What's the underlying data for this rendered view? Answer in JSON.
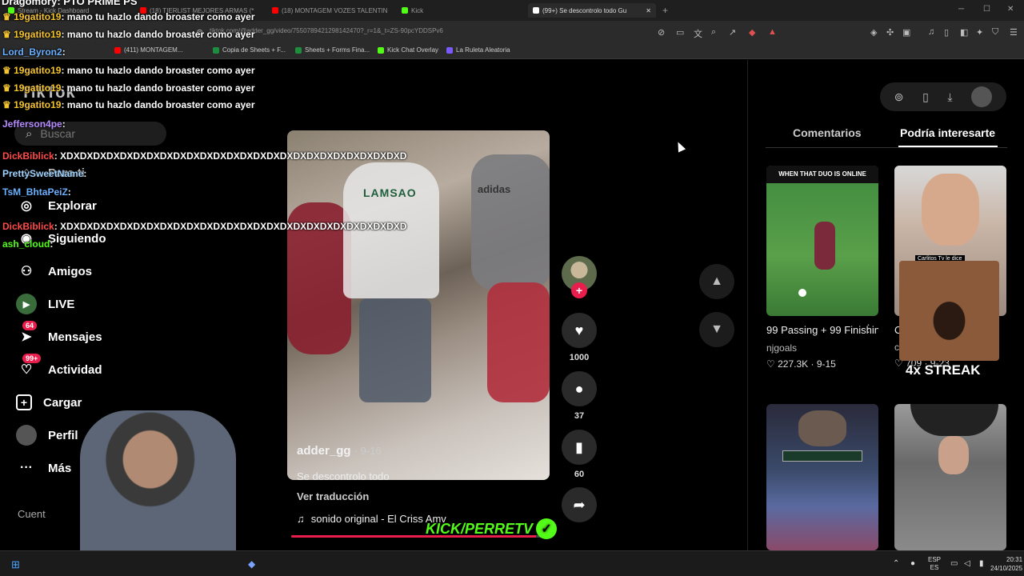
{
  "browser": {
    "tabs": [
      {
        "label": "Stream - Kick Dashboard",
        "color": "#53fc18"
      },
      {
        "label": "(18) TIERLIST MEJORES ARMAS (*",
        "color": "#ff0000"
      },
      {
        "label": "(18) MONTAGEM VOZES TALENTIN",
        "color": "#ff0000"
      },
      {
        "label": "Kick",
        "color": "#53fc18"
      },
      {
        "label": "(99+) Se descontrolo todo Gu",
        "color": "#ffffff"
      }
    ],
    "new_tab": "+",
    "url": "tiktok.com/@adder_gg/video/7550789421298142470?_r=1&_t=ZS-90pcYDDSPv6",
    "bookmarks": [
      {
        "label": "(411) MONTAGEM...",
        "color": "#ff0000"
      },
      {
        "label": "Copia de Sheets + F...",
        "color": "#1e8e3e"
      },
      {
        "label": "Sheets + Forms Fina...",
        "color": "#1e8e3e"
      },
      {
        "label": "Kick Chat Overlay",
        "color": "#53fc18"
      },
      {
        "label": "La Ruleta Aleatoria",
        "color": "#7a5af8"
      }
    ],
    "win_min": "─",
    "win_max": "☐",
    "win_close": "✕"
  },
  "tiktok": {
    "logo": "TikTok",
    "search_placeholder": "Buscar",
    "nav": [
      {
        "label": "Para ti",
        "icon": "home-icon"
      },
      {
        "label": "Explorar",
        "icon": "compass-icon"
      },
      {
        "label": "Siguiendo",
        "icon": "following-icon"
      },
      {
        "label": "Amigos",
        "icon": "friends-icon"
      },
      {
        "label": "LIVE",
        "icon": "live-icon"
      },
      {
        "label": "Mensajes",
        "icon": "messages-icon",
        "badge": "64"
      },
      {
        "label": "Actividad",
        "icon": "activity-icon",
        "badge": "99+"
      },
      {
        "label": "Cargar",
        "icon": "upload-icon"
      },
      {
        "label": "Perfil",
        "icon": "profile-icon"
      },
      {
        "label": "Más",
        "icon": "more-icon"
      }
    ],
    "cuentas_label": "Cuent",
    "video": {
      "author": "adder_gg",
      "date": "· 9-16",
      "description": "Se descontrolo todo",
      "translate": "Ver traducción",
      "sound": "sonido original - El Criss Amv",
      "progress": 0.95,
      "shirt_text_1": "LAMSAO",
      "shirt_text_2": "adidas"
    },
    "actions": {
      "likes": "1000",
      "comments": "37",
      "saves": "60"
    },
    "panel": {
      "tab_comments": "Comentarios",
      "tab_interest": "Podría interesarte",
      "cards": [
        {
          "overlay": "WHEN THAT DUO IS ONLINE",
          "title": "99 Passing + 99 Finishing☠️ 🔥 ...",
          "author": "njgoals",
          "likes": "227.3K",
          "date": "9-15"
        },
        {
          "overlay": "Carlitos Tv le dice",
          "title": "C",
          "author": "clips_kick1",
          "likes": "709",
          "date": "9-23"
        },
        {
          "overlay": "",
          "title": "",
          "author": "",
          "likes": "",
          "date": ""
        },
        {
          "overlay": "",
          "title": "",
          "author": "",
          "likes": "",
          "date": ""
        }
      ]
    }
  },
  "stream_overlay": {
    "top_user": "Dragomory: PTO PRIME PS",
    "chat": [
      {
        "user": "19gatito19",
        "message": "mano tu hazlo dando broaster como ayer",
        "color": "#f4c430"
      },
      {
        "user": "19gatito19",
        "message": "mano tu hazlo dando broaster como ayer",
        "color": "#f4c430"
      },
      {
        "user": "Lord_Byron2",
        "message": "",
        "color": "#6ab0ff"
      },
      {
        "user": "19gatito19",
        "message": "mano tu hazlo dando broaster como ayer",
        "color": "#f4c430"
      },
      {
        "user": "19gatito19",
        "message": "mano tu hazlo dando broaster como ayer",
        "color": "#f4c430"
      },
      {
        "user": "19gatito19",
        "message": "mano tu hazlo dando broaster como ayer",
        "color": "#f4c430"
      },
      {
        "user": "Jefferson4pe",
        "message": "",
        "color": "#b58cff"
      },
      {
        "user": "DickBiblick",
        "message": "XDXDXDXDXDXDXDXDXDXDXDXDXDXDXDXDXDXDXDXDXDXDXDXDXDXD",
        "color": "#ff4b4b"
      },
      {
        "user": "PrettySweetName",
        "message": "",
        "color": "#9fd3ff"
      },
      {
        "user": "TsM_BhtaPeiZ",
        "message": "",
        "color": "#6ab0ff"
      },
      {
        "user": "DickBiblick",
        "message": "XDXDXDXDXDXDXDXDXDXDXDXDXDXDXDXDXDXDXDXDXDXDXDXDXDXD",
        "color": "#ff4b4b"
      },
      {
        "user": "ash_cloud",
        "message": "",
        "color": "#53fc18"
      }
    ],
    "kick_badge": "KICK/PERRETV",
    "streak": "4x STREAK"
  },
  "taskbar": {
    "lang": "ESP",
    "lang2": "ES",
    "time": "20:31",
    "date": "24/10/2025"
  }
}
